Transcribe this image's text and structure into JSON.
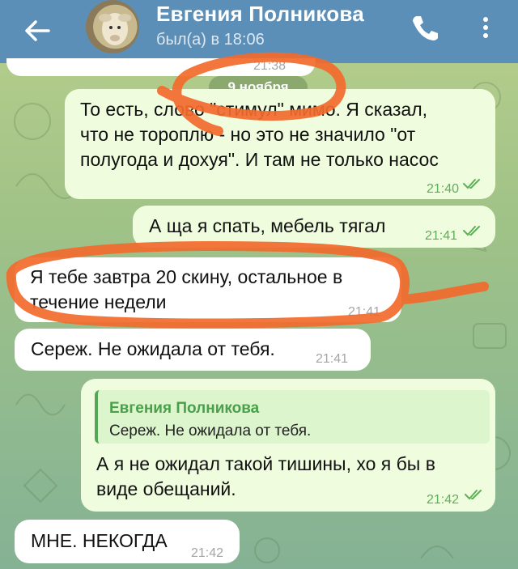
{
  "header": {
    "contact_name": "Евгения Полникова",
    "status": "был(а) в 18:06"
  },
  "previous_message": {
    "time": "21:38"
  },
  "date_separator": "9 ноября",
  "messages": [
    {
      "direction": "outgoing",
      "lines": [
        "То есть, слово \"стимул\" мимо. Я сказал,",
        "что не тороплю - но это не значило \"от",
        "полугода и дохуя\". И там не только насос"
      ],
      "time": "21:40",
      "read": true
    },
    {
      "direction": "outgoing",
      "lines": [
        "А ща я спать, мебель тягал"
      ],
      "time": "21:41",
      "read": true
    },
    {
      "direction": "incoming",
      "lines": [
        "Я тебе завтра 20 скину, остальное в",
        "течение недели"
      ],
      "time": "21:41"
    },
    {
      "direction": "incoming",
      "lines": [
        "Сереж. Не ожидала от тебя."
      ],
      "time": "21:41"
    },
    {
      "direction": "outgoing",
      "reply_to": {
        "name": "Евгения Полникова",
        "text": "Сереж. Не ожидала от тебя."
      },
      "lines": [
        "А я не ожидал такой тишины, хо я бы в",
        "виде обещаний."
      ],
      "time": "21:42",
      "read": true
    },
    {
      "direction": "incoming",
      "lines": [
        "МНЕ. НЕКОГДА"
      ],
      "time": "21:42"
    }
  ],
  "colors": {
    "header": "#5b8fb7",
    "outgoing_bubble": "#effdde",
    "incoming_bubble": "#ffffff",
    "read_ticks": "#5fae58",
    "marker_annotation": "#f26a2c"
  },
  "icons": [
    "back-arrow-icon",
    "phone-icon",
    "more-vertical-icon",
    "double-check-icon"
  ]
}
